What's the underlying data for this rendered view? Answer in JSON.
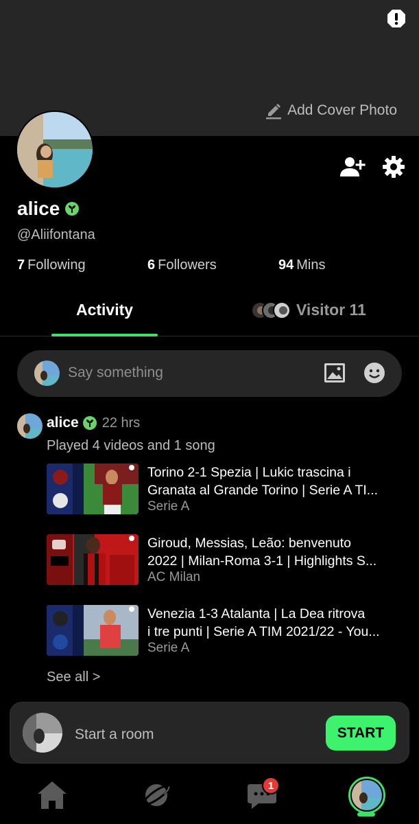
{
  "profile": {
    "add_cover_label": "Add Cover Photo",
    "name": "alice",
    "handle": "@Aliifontana",
    "stats": [
      {
        "value": "7",
        "label": "Following"
      },
      {
        "value": "6",
        "label": "Followers"
      },
      {
        "value": "94",
        "label": "Mins"
      }
    ]
  },
  "tabs": {
    "activity": "Activity",
    "visitor": "Visitor 11"
  },
  "composer": {
    "placeholder": "Say something"
  },
  "post": {
    "author": "alice",
    "time": "22 hrs",
    "summary": "Played 4 videos and 1 song",
    "videos": [
      {
        "title_line1": "Torino 2-1 Spezia | Lukic trascina i",
        "title_line2": "Granata al Grande Torino | Serie A TI...",
        "channel": "Serie A"
      },
      {
        "title_line1": "Giroud, Messias, Leão: benvenuto",
        "title_line2": "2022 | Milan-Roma 3-1 | Highlights S...",
        "channel": "AC Milan"
      },
      {
        "title_line1": "Venezia 1-3 Atalanta | La Dea ritrova",
        "title_line2": "i tre punti | Serie A TIM 2021/22 - You...",
        "channel": "Serie A"
      }
    ],
    "see_all": "See all >"
  },
  "room_bar": {
    "label": "Start a room",
    "button": "START"
  },
  "nav": {
    "messages_badge": "1"
  },
  "colors": {
    "accent": "#3ee06a",
    "start_button": "#3df36d",
    "badge_red": "#e53935",
    "surface": "#262626"
  }
}
